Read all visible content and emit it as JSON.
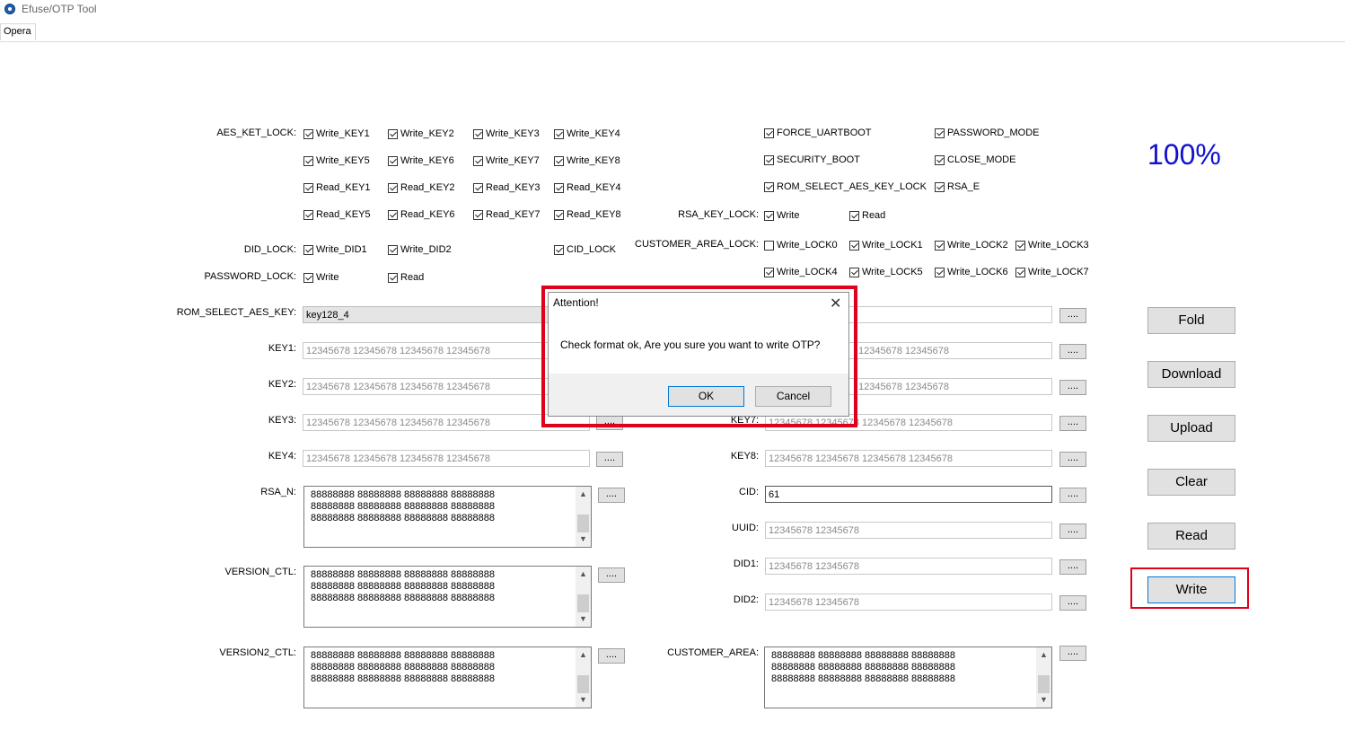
{
  "window": {
    "title": "Efuse/OTP Tool",
    "tab": "Opera"
  },
  "progress": "100%",
  "aes_ket_lock": {
    "label": "AES_KET_LOCK:",
    "rows": [
      [
        "Write_KEY1",
        "Write_KEY2",
        "Write_KEY3",
        "Write_KEY4"
      ],
      [
        "Write_KEY5",
        "Write_KEY6",
        "Write_KEY7",
        "Write_KEY8"
      ],
      [
        "Read_KEY1",
        "Read_KEY2",
        "Read_KEY3",
        "Read_KEY4"
      ],
      [
        "Read_KEY5",
        "Read_KEY6",
        "Read_KEY7",
        "Read_KEY8"
      ]
    ]
  },
  "did_lock": {
    "label": "DID_LOCK:",
    "items": [
      "Write_DID1",
      "Write_DID2"
    ],
    "cid_lock": "CID_LOCK"
  },
  "password_lock": {
    "label": "PASSWORD_LOCK:",
    "items": [
      "Write",
      "Read"
    ]
  },
  "right_flags": {
    "force_uartboot": "FORCE_UARTBOOT",
    "password_mode": "PASSWORD_MODE",
    "security_boot": "SECURITY_BOOT",
    "close_mode": "CLOSE_MODE",
    "rom_select_aes_key_lock": "ROM_SELECT_AES_KEY_LOCK",
    "rsa_e": "RSA_E"
  },
  "rsa_key_lock": {
    "label": "RSA_KEY_LOCK:",
    "items": [
      "Write",
      "Read"
    ]
  },
  "customer_area_lock": {
    "label": "CUSTOMER_AREA_LOCK:",
    "row1": [
      "Write_LOCK0",
      "Write_LOCK1",
      "Write_LOCK2",
      "Write_LOCK3"
    ],
    "row2": [
      "Write_LOCK4",
      "Write_LOCK5",
      "Write_LOCK6",
      "Write_LOCK7"
    ]
  },
  "fields": {
    "rom_select_aes_key": {
      "label": "ROM_SELECT_AES_KEY:",
      "value": "key128_4"
    },
    "key1": {
      "label": "KEY1:",
      "value": "12345678 12345678 12345678 12345678"
    },
    "key2": {
      "label": "KEY2:",
      "value": "12345678 12345678 12345678 12345678"
    },
    "key3": {
      "label": "KEY3:",
      "value": "12345678 12345678 12345678 12345678"
    },
    "key4": {
      "label": "KEY4:",
      "value": "12345678 12345678 12345678 12345678"
    },
    "key6_partial": "12345678 12345678",
    "key6_partial2": "12345678 12345678",
    "key7": {
      "label": "KEY7:",
      "value": "12345678 12345678 12345678 12345678"
    },
    "key8": {
      "label": "KEY8:",
      "value": "12345678 12345678 12345678 12345678"
    },
    "cid": {
      "label": "CID:",
      "value": "61"
    },
    "uuid": {
      "label": "UUID:",
      "value": "12345678 12345678"
    },
    "did1": {
      "label": "DID1:",
      "value": "12345678 12345678"
    },
    "did2": {
      "label": "DID2:",
      "value": "12345678 12345678"
    }
  },
  "text_areas": {
    "rsa_n": {
      "label": "RSA_N:",
      "value": "88888888 88888888 88888888 88888888\n88888888 88888888 88888888 88888888\n88888888 88888888 88888888 88888888"
    },
    "version_ctl": {
      "label": "VERSION_CTL:",
      "value": "88888888 88888888 88888888 88888888\n88888888 88888888 88888888 88888888\n88888888 88888888 88888888 88888888"
    },
    "version2_ctl": {
      "label": "VERSION2_CTL:",
      "value": "88888888 88888888 88888888 88888888\n88888888 88888888 88888888 88888888\n88888888 88888888 88888888 88888888"
    },
    "customer_area": {
      "label": "CUSTOMER_AREA:",
      "value": "88888888 88888888 88888888 88888888\n88888888 88888888 88888888 88888888\n88888888 88888888 88888888 88888888"
    }
  },
  "browse_label": "....",
  "actions": {
    "fold": "Fold",
    "download": "Download",
    "upload": "Upload",
    "clear": "Clear",
    "read": "Read",
    "write": "Write"
  },
  "dialog": {
    "title": "Attention!",
    "message": "Check format ok, Are you sure you want to write OTP?",
    "ok": "OK",
    "cancel": "Cancel",
    "close_glyph": "✕"
  },
  "colors": {
    "highlight": "#e0001b",
    "percent": "#1010d0"
  }
}
